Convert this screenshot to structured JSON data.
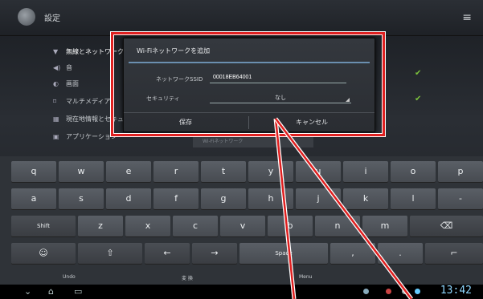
{
  "header": {
    "title": "設定"
  },
  "sidebar": {
    "items": [
      {
        "label": "無線とネットワーク",
        "icon": "wifi-icon",
        "glyph": "▼"
      },
      {
        "label": "音",
        "icon": "sound-icon",
        "glyph": "◀)"
      },
      {
        "label": "画面",
        "icon": "display-icon",
        "glyph": "◐"
      },
      {
        "label": "マルチメディア",
        "icon": "multimedia-icon",
        "glyph": "⌑"
      },
      {
        "label": "現在地情報とセキュリティ",
        "icon": "location-icon",
        "glyph": "▦"
      },
      {
        "label": "アプリケーション",
        "icon": "apps-icon",
        "glyph": "▣"
      }
    ]
  },
  "background": {
    "faint_field": "Wi-Fiネットワーク"
  },
  "dialog": {
    "title": "Wi-Fiネットワークを追加",
    "ssid_label": "ネットワークSSID",
    "ssid_value": "00018EB64001",
    "security_label": "セキュリティ",
    "security_value": "なし",
    "save_label": "保存",
    "cancel_label": "キャンセル"
  },
  "keyboard": {
    "row1": [
      "q",
      "w",
      "e",
      "r",
      "t",
      "y",
      "u",
      "i",
      "o",
      "p"
    ],
    "row2": [
      "a",
      "s",
      "d",
      "f",
      "g",
      "h",
      "j",
      "k",
      "l",
      "-"
    ],
    "row3": [
      "Shift",
      "z",
      "x",
      "c",
      "v",
      "b",
      "n",
      "m",
      "⌫"
    ],
    "row4": [
      "☺",
      "⇧",
      "←",
      "→",
      "Space",
      ",",
      ".",
      "⌐"
    ],
    "bottom_labels": {
      "undo": "Undo",
      "kanji": "変 換",
      "menu": "Menu"
    }
  },
  "statusbar": {
    "time": "13:42"
  },
  "colors": {
    "accent_blue": "#6b8fb0",
    "highlight_red": "#e02020",
    "check_green": "#7bc23c"
  }
}
